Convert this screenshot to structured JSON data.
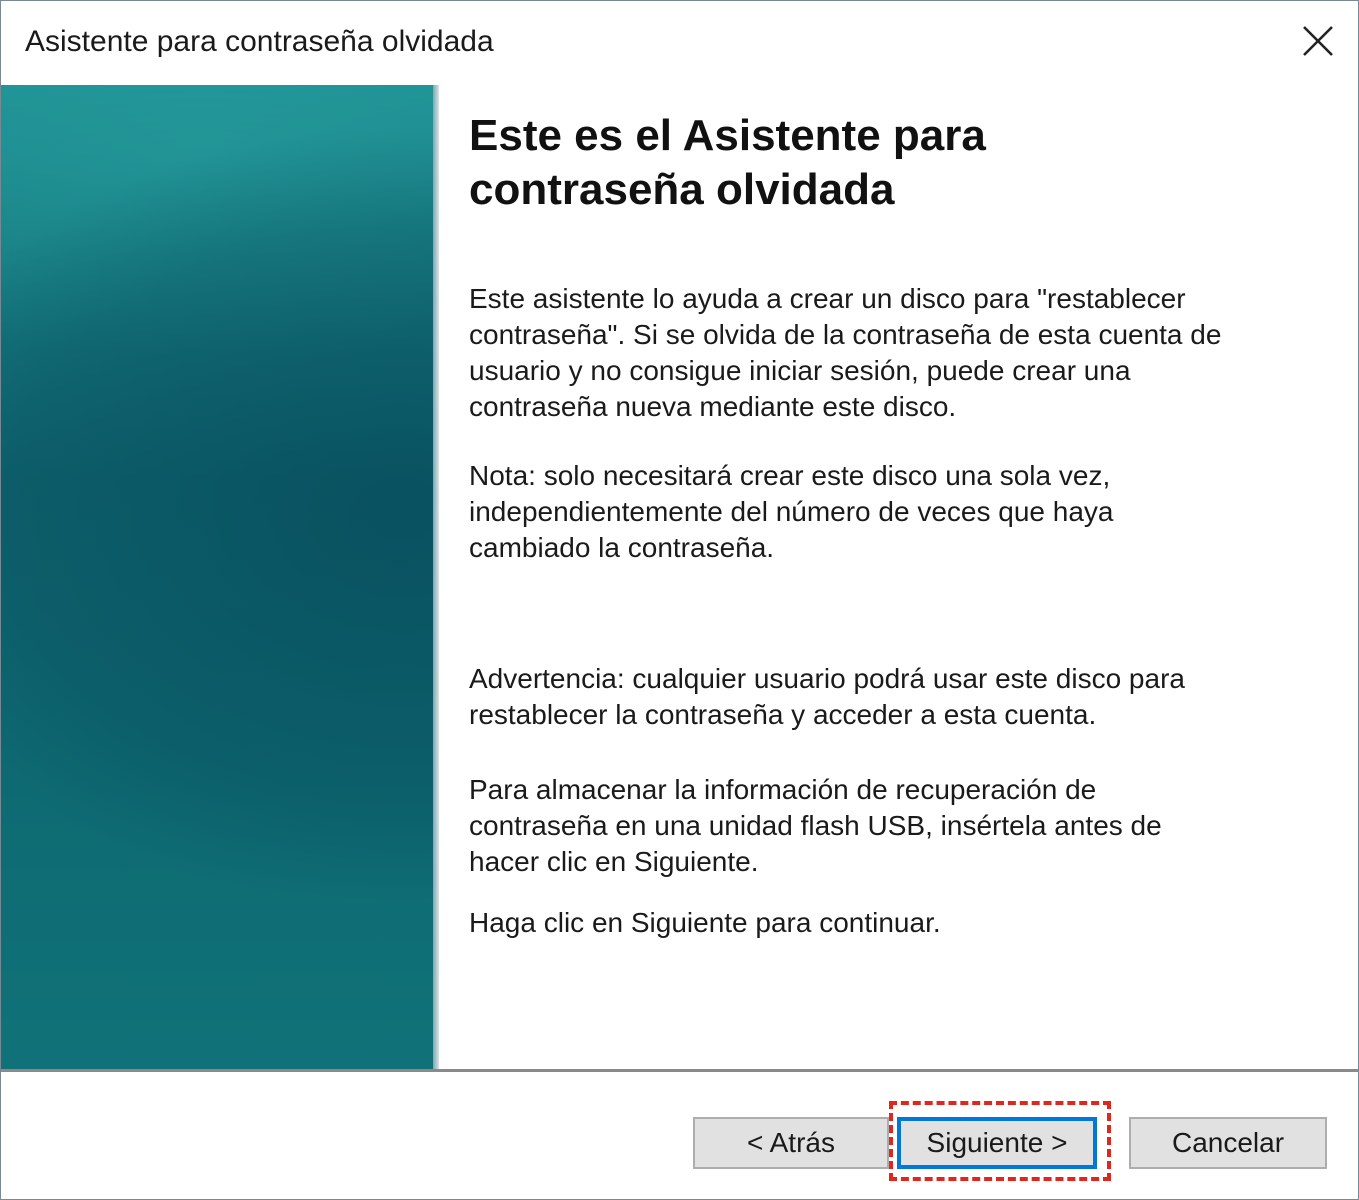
{
  "window": {
    "title": "Asistente para contraseña olvidada",
    "close_glyph": "✕"
  },
  "content": {
    "heading": "Este es el Asistente para contraseña olvidada",
    "paragraphs": [
      "Este asistente lo ayuda a crear un disco para \"restablecer contraseña\". Si se olvida de la contraseña de esta cuenta de usuario y no consigue iniciar sesión, puede crear una contraseña nueva mediante este disco.",
      "Nota: solo necesitará crear este disco una sola vez, independientemente del número de veces que haya cambiado la contraseña.",
      "Advertencia: cualquier usuario podrá usar este disco para restablecer la contraseña y acceder a esta cuenta.",
      "Para almacenar la información de recuperación de contraseña en una unidad flash USB, insértela antes de hacer clic en Siguiente.",
      "Haga clic en Siguiente para continuar."
    ]
  },
  "buttons": {
    "back": "< Atrás",
    "next": "Siguiente >",
    "cancel": "Cancelar"
  },
  "colors": {
    "sidebar_teal": "#0f6670",
    "focus_blue": "#0078d7",
    "highlight_red": "#e0271d"
  },
  "icons": {
    "close": "close-icon"
  }
}
